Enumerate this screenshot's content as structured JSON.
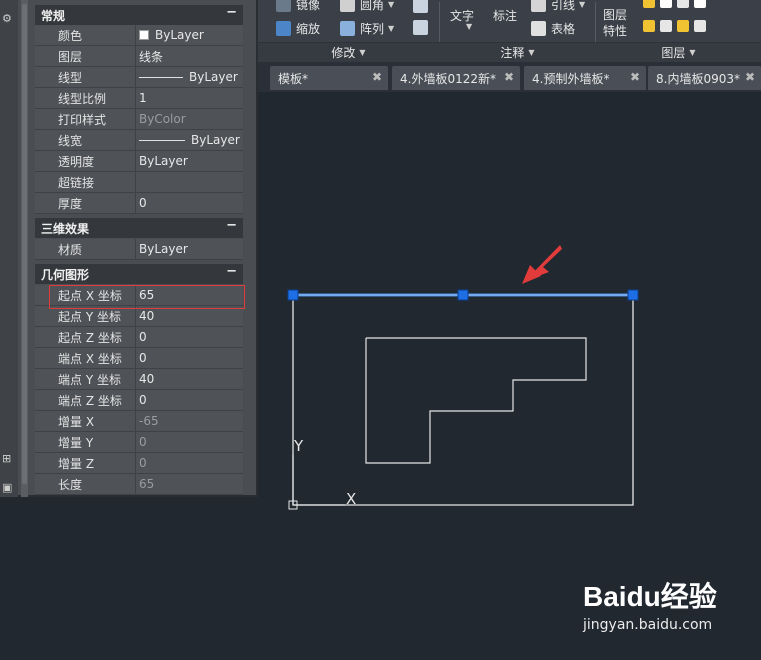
{
  "ribbon": {
    "modify_items": {
      "mirror": "镜像",
      "fillet": "圆角",
      "scale": "缩放",
      "array": "阵列"
    },
    "annotation_items": {
      "text": "文字",
      "dimension": "标注",
      "leader": "引线",
      "table": "表格"
    },
    "layer_items": {
      "layer_props_line1": "图层",
      "layer_props_line2": "特性"
    },
    "group_labels": {
      "modify": "修改",
      "annotation": "注释",
      "layers": "图层"
    }
  },
  "tabs": [
    {
      "label": "模板*"
    },
    {
      "label": "4.外墙板0122新*"
    },
    {
      "label": "4.预制外墙板*"
    },
    {
      "label": "8.内墙板0903*"
    }
  ],
  "palette": {
    "sections": {
      "general": "常规",
      "three_d": "三维效果",
      "geometry": "几何图形"
    },
    "toggle": "−",
    "general_rows": [
      {
        "label": "颜色",
        "value": "ByLayer"
      },
      {
        "label": "图层",
        "value": "线条"
      },
      {
        "label": "线型",
        "value": "ByLayer"
      },
      {
        "label": "线型比例",
        "value": "1"
      },
      {
        "label": "打印样式",
        "value": "ByColor"
      },
      {
        "label": "线宽",
        "value": "ByLayer"
      },
      {
        "label": "透明度",
        "value": "ByLayer"
      },
      {
        "label": "超链接",
        "value": ""
      },
      {
        "label": "厚度",
        "value": "0"
      }
    ],
    "three_d_rows": [
      {
        "label": "材质",
        "value": "ByLayer"
      }
    ],
    "geometry_rows": [
      {
        "label": "起点 X 坐标",
        "value": "65"
      },
      {
        "label": "起点 Y 坐标",
        "value": "40"
      },
      {
        "label": "起点 Z 坐标",
        "value": "0"
      },
      {
        "label": "端点 X 坐标",
        "value": "0"
      },
      {
        "label": "端点 Y 坐标",
        "value": "40"
      },
      {
        "label": "端点 Z 坐标",
        "value": "0"
      },
      {
        "label": "增量 X",
        "value": "-65"
      },
      {
        "label": "增量 Y",
        "value": "0"
      },
      {
        "label": "增量 Z",
        "value": "0"
      },
      {
        "label": "长度",
        "value": "65"
      }
    ]
  },
  "ucs": {
    "x_label": "X",
    "y_label": "Y"
  },
  "watermark": {
    "brand": "Baidu经验",
    "sub": "jingyan.baidu.com"
  },
  "colors": {
    "canvas": "#212830",
    "selected_line": "#4a8fe8",
    "grip": "#1e6fe6",
    "arrow": "#e23b3b",
    "geometry": "#e6e6e6"
  }
}
